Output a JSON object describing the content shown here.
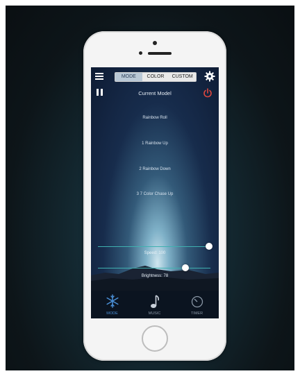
{
  "segments": [
    {
      "label": "MODE",
      "active": true
    },
    {
      "label": "COLOR",
      "active": false
    },
    {
      "label": "CUSTOM",
      "active": false
    }
  ],
  "current_mode_title": "Current Model",
  "modes": [
    "Rainbow Roll",
    "1 Rainbow Up",
    "2 Rainbow Down",
    "3 7 Color Chase Up"
  ],
  "sliders": {
    "speed": {
      "label": "Speed: 100",
      "value": 1.0
    },
    "brightness": {
      "label": "Brightness: 78",
      "value": 0.78
    }
  },
  "tabs": [
    {
      "label": "MODE",
      "icon": "snowflake-icon",
      "active": true
    },
    {
      "label": "MUSIC",
      "icon": "music-note-icon",
      "active": false
    },
    {
      "label": "TIMER",
      "icon": "timer-icon",
      "active": false
    }
  ],
  "colors": {
    "accent_blue": "#4a8fd6",
    "power_red": "#e0473e",
    "slider_teal": "#3fb1b0"
  }
}
